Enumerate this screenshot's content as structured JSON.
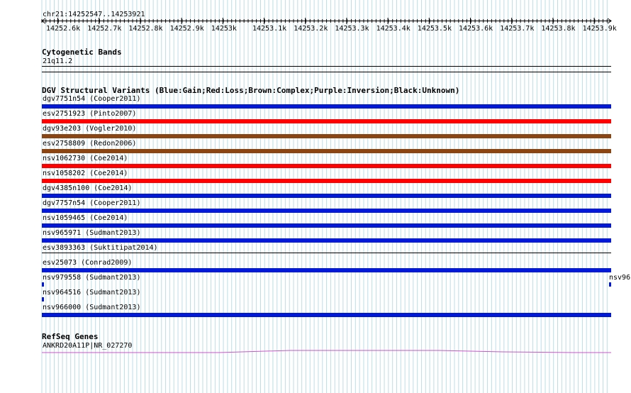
{
  "ruler": {
    "region": "chr21:14252547..14253921",
    "ticks": [
      "14252.6k",
      "14252.7k",
      "14252.8k",
      "14252.9k",
      "14253k",
      "14253.1k",
      "14253.2k",
      "14253.3k",
      "14253.4k",
      "14253.5k",
      "14253.6k",
      "14253.7k",
      "14253.8k",
      "14253.9k"
    ]
  },
  "cytoband": {
    "title": "Cytogenetic Bands",
    "band": "21q11.2"
  },
  "dgv": {
    "title": "DGV Structural Variants (Blue:Gain;Red:Loss;Brown:Complex;Purple:Inversion;Black:Unknown)",
    "colors": {
      "gain": "#0018d8",
      "loss": "#ff0000",
      "complex": "#8b4513",
      "unknown": "#000000"
    },
    "tracks": [
      {
        "label": "dgv7751n54 (Cooper2011)",
        "type": "gain"
      },
      {
        "label": "esv2751923 (Pinto2007)",
        "type": "loss"
      },
      {
        "label": "dgv93e203 (Vogler2010)",
        "type": "complex"
      },
      {
        "label": "esv2758809 (Redon2006)",
        "type": "complex"
      },
      {
        "label": "nsv1062730 (Coe2014)",
        "type": "loss"
      },
      {
        "label": "nsv1058202 (Coe2014)",
        "type": "loss"
      },
      {
        "label": "dgv4385n100 (Coe2014)",
        "type": "gain"
      },
      {
        "label": "dgv7757n54 (Cooper2011)",
        "type": "gain"
      },
      {
        "label": "nsv1059465 (Coe2014)",
        "type": "gain"
      },
      {
        "label": "nsv965971 (Sudmant2013)",
        "type": "gain"
      },
      {
        "label": "esv3893363 (Suktitipat2014)",
        "type": "unknown"
      },
      {
        "label": "esv25073 (Conrad2009)",
        "type": "gain"
      },
      {
        "label": "nsv979558 (Sudmant2013)",
        "type": "gain",
        "short": true
      },
      {
        "label": "nsv964516 (Sudmant2013)",
        "type": "gain",
        "short": true
      },
      {
        "label": "nsv966000 (Sudmant2013)",
        "type": "gain"
      }
    ],
    "offscreen_label": "nsv96"
  },
  "refseq": {
    "title": "RefSeq Genes",
    "gene": "ANKRD20A11P|NR_027270",
    "color": "#cc55cc"
  }
}
